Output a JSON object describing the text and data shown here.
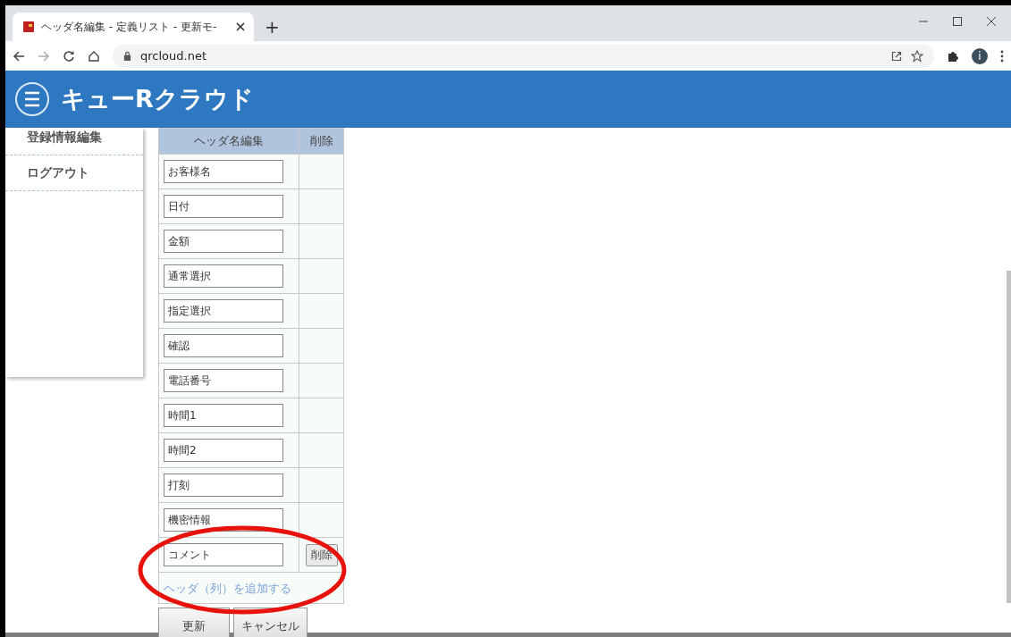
{
  "browser": {
    "tab_title": "ヘッダ名編集 - 定義リスト - 更新モ-",
    "new_tab": "+",
    "url": "qrcloud.net",
    "profile_initial": "i"
  },
  "header": {
    "title": "キューRクラウド"
  },
  "sidebar": {
    "items": [
      {
        "label": "登録情報編集"
      },
      {
        "label": "ログアウト"
      }
    ]
  },
  "table": {
    "columns": [
      "ヘッダ名編集",
      "削除"
    ],
    "rows": [
      {
        "value": "お客様名"
      },
      {
        "value": "日付"
      },
      {
        "value": "金額"
      },
      {
        "value": "通常選択"
      },
      {
        "value": "指定選択"
      },
      {
        "value": "確認"
      },
      {
        "value": "電話番号"
      },
      {
        "value": "時間1"
      },
      {
        "value": "時間2"
      },
      {
        "value": "打刻"
      },
      {
        "value": "機密情報"
      },
      {
        "value": "コメント",
        "delete_button": "削除"
      }
    ],
    "add_link": "ヘッダ（列）を追加する"
  },
  "buttons": [
    "更新",
    "キャンセル"
  ]
}
